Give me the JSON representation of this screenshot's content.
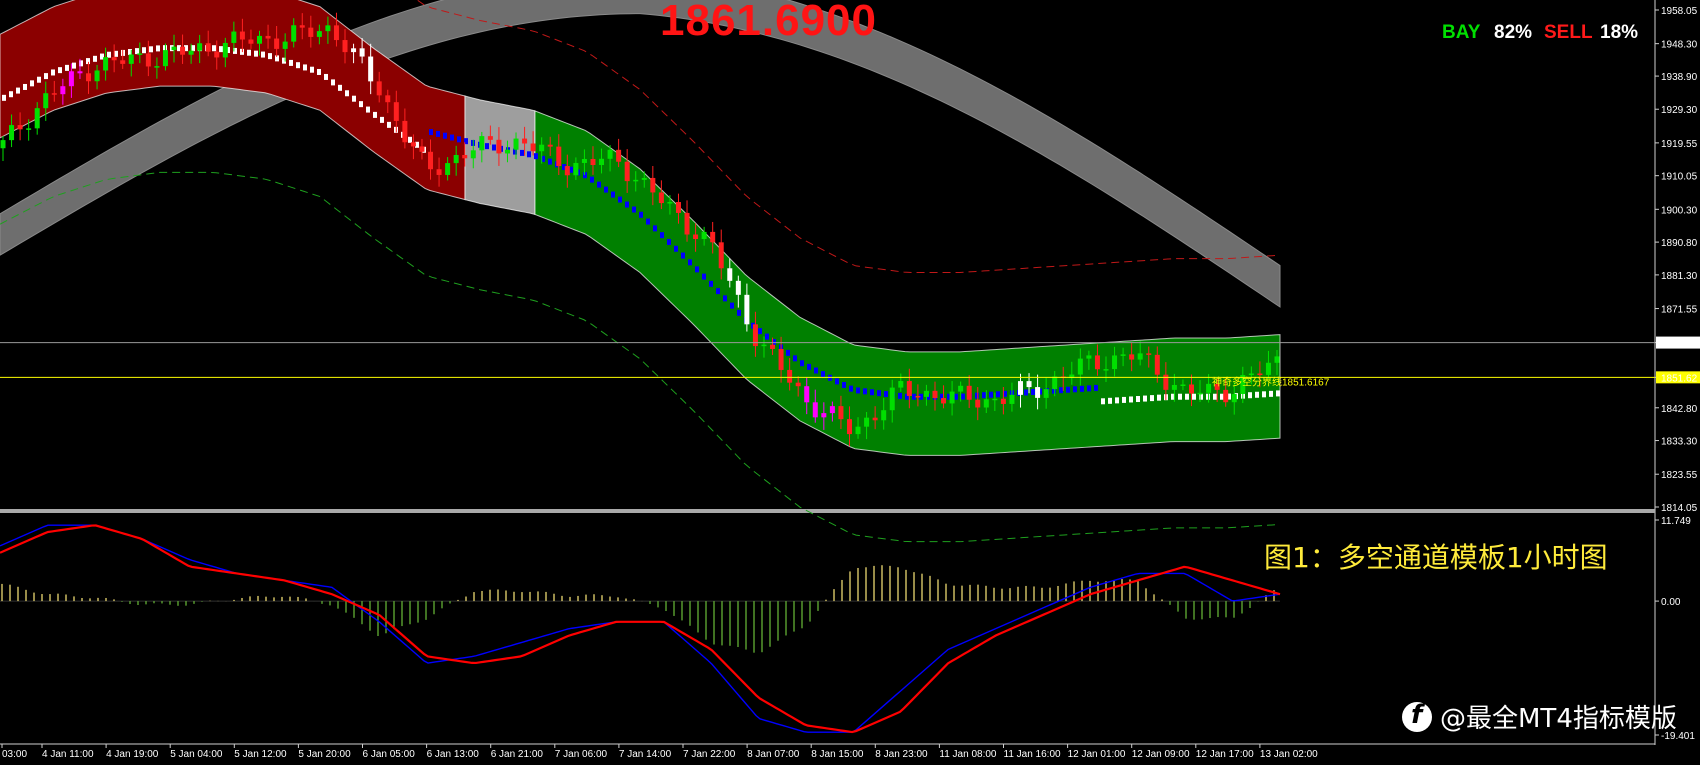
{
  "header": {
    "current_price": "1861.6900",
    "bay_label": "BAY",
    "bay_value": "82%",
    "sell_label": "SELL",
    "sell_value": "18%"
  },
  "caption": "图1：多空通道模板1小时图",
  "watermark": "@最全MT4指标模版",
  "line_label": "神奇多空分界线1851.6167",
  "colors": {
    "bull_channel": "#008000",
    "bear_channel": "#8b0000",
    "neutral_channel": "#9e9e9e",
    "cloud": "#6e6e6e",
    "trail_up": "#ffffff",
    "trail_down": "#0000ff",
    "candle_up": "#00e000",
    "candle_down": "#ff2020",
    "candle_extreme": "#ff00ff",
    "macd_line": "#ff0000",
    "signal_line": "#0000ff",
    "hist_pos": "#ffeb7a",
    "hist_neg": "#6bbf3a",
    "level_line": "#ffff00"
  },
  "chart_data": [
    {
      "type": "line",
      "panel": "price",
      "y_ticks": [
        "1958.05",
        "1948.30",
        "1938.90",
        "1929.30",
        "1919.55",
        "1910.05",
        "1900.30",
        "1890.80",
        "1881.30",
        "1871.55",
        "1861.69",
        "1851.62",
        "1842.80",
        "1833.30",
        "1823.55",
        "1814.05"
      ],
      "x_ticks": [
        "03:00",
        "4 Jan 11:00",
        "4 Jan 19:00",
        "5 Jan 04:00",
        "5 Jan 12:00",
        "5 Jan 20:00",
        "6 Jan 05:00",
        "6 Jan 13:00",
        "6 Jan 21:00",
        "7 Jan 06:00",
        "7 Jan 14:00",
        "7 Jan 22:00",
        "8 Jan 07:00",
        "8 Jan 15:00",
        "8 Jan 23:00",
        "11 Jan 08:00",
        "11 Jan 16:00",
        "12 Jan 01:00",
        "12 Jan 09:00",
        "12 Jan 17:00",
        "13 Jan 02:00"
      ],
      "ylim": [
        1814.05,
        1958.05
      ],
      "current_price": 1861.69,
      "level_line": 1851.62,
      "channel_center": [
        1936,
        1944,
        1949,
        1951,
        1951,
        1949,
        1944,
        1932,
        1921,
        1917,
        1914,
        1908,
        1897,
        1882,
        1866,
        1854,
        1846,
        1844,
        1844,
        1845,
        1846,
        1847,
        1848,
        1848,
        1849
      ],
      "channel_half_width": 15,
      "close": [
        1918,
        1933,
        1942,
        1944,
        1946,
        1949,
        1950,
        1953,
        1935,
        1911,
        1918,
        1920,
        1913,
        1915,
        1902,
        1890,
        1862,
        1845,
        1836,
        1848,
        1846,
        1845,
        1849,
        1856,
        1858,
        1847,
        1848,
        1857
      ]
    },
    {
      "type": "line",
      "panel": "oscillator",
      "y_ticks": [
        "11.749",
        "0.00",
        "-19.401"
      ],
      "ylim": [
        -19.401,
        11.749
      ],
      "macd": [
        7,
        10,
        11,
        9,
        5,
        4,
        3,
        1,
        -2,
        -8,
        -9,
        -8,
        -5,
        -3,
        -3,
        -7,
        -14,
        -18,
        -19,
        -16,
        -9,
        -5,
        -2,
        1,
        3,
        5,
        3,
        1
      ],
      "signal": [
        8,
        11,
        11,
        9,
        6,
        4,
        3,
        2,
        -3,
        -9,
        -8,
        -6,
        -4,
        -3,
        -3,
        -9,
        -17,
        -19,
        -19,
        -13,
        -7,
        -4,
        -1,
        2,
        4,
        4,
        0,
        1
      ],
      "histogram": [
        2.5,
        1,
        0.5,
        -0.5,
        -0.5,
        0.4,
        0.8,
        -0.5,
        -5,
        -2.5,
        1.5,
        1.5,
        0.8,
        0.8,
        -1,
        -6,
        -7.5,
        -3.5,
        5,
        5,
        2.5,
        2,
        2,
        3,
        3,
        -2.5,
        -2.5,
        2
      ]
    }
  ]
}
